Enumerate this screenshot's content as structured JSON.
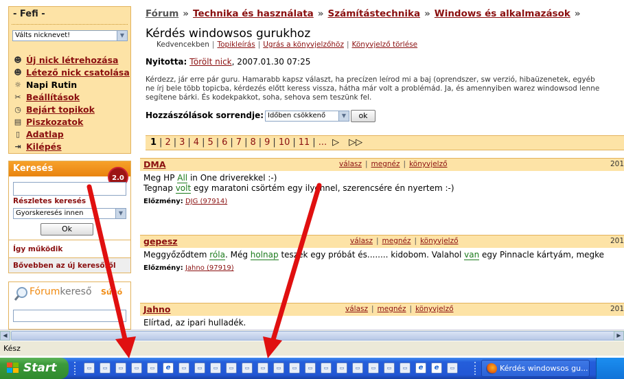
{
  "sidebar": {
    "user_title": "- Fefi -",
    "nick_select": "Válts nicknevet!",
    "menu": [
      {
        "icon": "spy-icon",
        "glyph": "☻",
        "label": "Új nick létrehozása",
        "link": true
      },
      {
        "icon": "spy-red-icon",
        "glyph": "☻",
        "label": "Létező nick csatolása",
        "link": true
      },
      {
        "icon": "sun-icon",
        "glyph": "☼",
        "label": "Napi Rutin",
        "link": false
      },
      {
        "icon": "tools-icon",
        "glyph": "✂",
        "label": "Beállítások",
        "link": true
      },
      {
        "icon": "clock-icon",
        "glyph": "◷",
        "label": "Bejárt topikok",
        "link": true
      },
      {
        "icon": "note-icon",
        "glyph": "▤",
        "label": "Piszkozatok",
        "link": true
      },
      {
        "icon": "document-icon",
        "glyph": "▯",
        "label": "Adatlap",
        "link": true
      },
      {
        "icon": "exit-icon",
        "glyph": "⇥",
        "label": "Kilépés",
        "link": true
      }
    ],
    "search": {
      "title": "Keresés",
      "badge": "2.0",
      "input_value": "",
      "advanced_link": "Részletes keresés",
      "scope_select": "Gyorskeresés innen",
      "ok_label": "Ok",
      "how_link": "Így működik",
      "more_link": "Bővebben az új keresőről"
    },
    "forumkereso": {
      "brand_a": "Fórum",
      "brand_b": "kereső",
      "help": "Súgó"
    }
  },
  "breadcrumb": {
    "items": [
      "Fórum",
      "Technika és használata",
      "Számítástechnika",
      "Windows és alkalmazások"
    ],
    "separator": "»"
  },
  "topic": {
    "title": "Kérdés windowsos gurukhoz",
    "sub_links": [
      "Kedvencekben",
      "Topikleírás",
      "Ugrás a könyvjelzőhöz",
      "Könyvjelző törlése"
    ],
    "opener_label": "Nyitotta:",
    "opener_name": "Törölt nick",
    "opened_at": ", 2007.01.30 07:25",
    "intro_line1": "Kérdezz, jár erre pár guru. Hamarabb kapsz választ, ha precízen leírod mi a baj (oprendszer, sw verzió, hibaüzenetek, egyéb",
    "intro_line2": "ne írj bele több topicba, kérdezés előtt keress vissza, hátha már volt a problémád. Ja, és amennyiben warez windowsod lenne",
    "intro_line3": "segítene bárki. És kodekpakkot, soha, sehova sem teszünk fel.",
    "order_label": "Hozzászólások sorrendje:",
    "order_value": "Időben csökkenő",
    "order_ok": "ok"
  },
  "pager": {
    "pages": [
      "1",
      "2",
      "3",
      "4",
      "5",
      "6",
      "7",
      "8",
      "9",
      "10",
      "11",
      "..."
    ],
    "current": "1"
  },
  "posts": [
    {
      "author": "DMA",
      "actions": [
        "válasz",
        "megnéz",
        "könyvjelző"
      ],
      "date": "201",
      "line1_a": "Meg HP ",
      "line1_kw": "All",
      "line1_b": " in One driverekkel :-)",
      "line2_a": "Tegnap ",
      "line2_kw": "volt",
      "line2_b": " egy maratoni csörtém egy ilyennel, szerencsére én nyertem :-)",
      "prev_label": "Előzmény:",
      "prev_link": "DJG (97914)"
    },
    {
      "author": "gepesz",
      "actions": [
        "válasz",
        "megnéz",
        "könyvjelző"
      ],
      "date": "201",
      "t1": "Meggyőződtem ",
      "k1": "róla",
      "t2": ". Még ",
      "k2": "holnap",
      "t3": " teszek egy próbát és........ kidobom. Valahol ",
      "k3": "van",
      "t4": " egy Pinnacle kártyám, megke",
      "prev_label": "Előzmény:",
      "prev_link": "Jahno (97919)"
    },
    {
      "author": "Jahno",
      "actions": [
        "válasz",
        "megnéz",
        "könyvjelző"
      ],
      "date": "201",
      "line1": "Elírtad, az ipari hulladék."
    }
  ],
  "statusbar": {
    "text": "Kész"
  },
  "taskbar": {
    "start_label": "Start",
    "task_label": "Kérdés windowsos gu...",
    "quicklaunch": [
      "app",
      "app",
      "app",
      "app",
      "app",
      "ie",
      "app",
      "app",
      "app",
      "app",
      "app",
      "app",
      "app",
      "app",
      "app",
      "app",
      "app",
      "app",
      "app",
      "app",
      "app",
      "ie",
      "ie",
      "app"
    ]
  },
  "annotation": {
    "color": "#e01010"
  }
}
